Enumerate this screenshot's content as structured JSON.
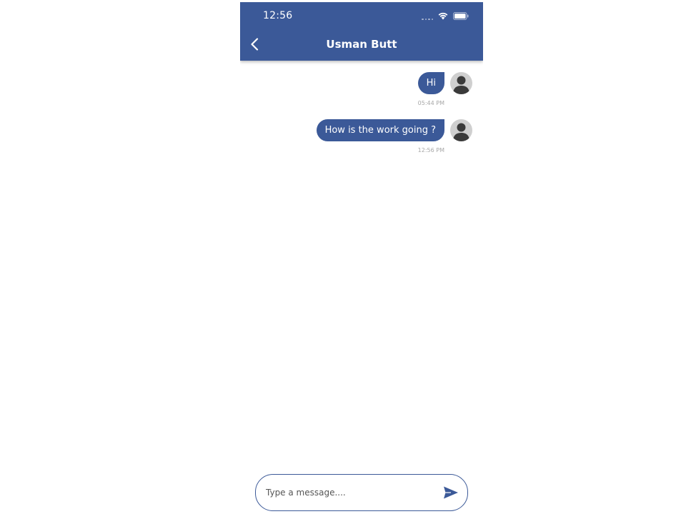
{
  "status_bar": {
    "time": "12:56"
  },
  "header": {
    "title": "Usman Butt",
    "back_icon": "chevron-left-icon"
  },
  "messages": [
    {
      "text": "Hi",
      "time": "05:44 PM",
      "sender": "self"
    },
    {
      "text": "How is the work going ?",
      "time": "12:56 PM",
      "sender": "self"
    }
  ],
  "composer": {
    "placeholder": "Type a message....",
    "value": "",
    "send_icon": "send-icon"
  },
  "colors": {
    "primary": "#3b5998",
    "bubble_text": "#ffffff",
    "timestamp": "#a7a7a7",
    "avatar_bg": "#cfcfcf",
    "avatar_fg": "#3a3a3a"
  }
}
